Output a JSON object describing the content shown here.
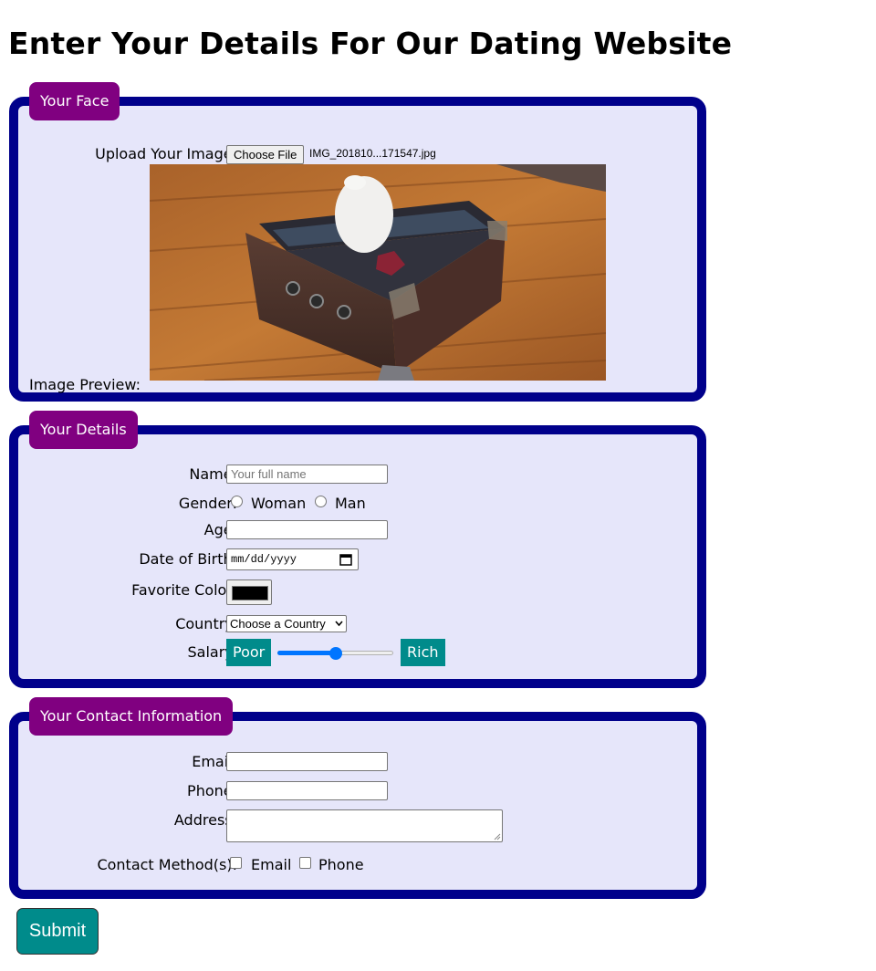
{
  "page": {
    "title": "Enter Your Details For Our Dating Website"
  },
  "face": {
    "legend": "Your Face",
    "upload_label": "Upload Your Image:",
    "choose_file_label": "Choose File",
    "file_name": "IMG_201810...171547.jpg",
    "preview_label": "Image Preview:"
  },
  "details": {
    "legend": "Your Details",
    "name_label": "Name:",
    "name_placeholder": "Your full name",
    "gender_label": "Gender:",
    "gender_options": [
      "Woman",
      "Man"
    ],
    "age_label": "Age:",
    "dob_label": "Date of Birth:",
    "dob_placeholder": "mm/dd/yyyy",
    "color_label": "Favorite Color:",
    "color_value": "#000000",
    "country_label": "Country:",
    "country_selected": "Choose a Country",
    "salary_label": "Salary:",
    "salary_min_label": "Poor",
    "salary_max_label": "Rich",
    "salary_value": 0.5
  },
  "contact": {
    "legend": "Your Contact Information",
    "email_label": "Email:",
    "phone_label": "Phone:",
    "address_label": "Address:",
    "method_label": "Contact Method(s):",
    "method_options": [
      "Email",
      "Phone"
    ]
  },
  "submit_label": "Submit",
  "colors": {
    "panel_bg": "#e6e6fa",
    "panel_border": "#00008b",
    "legend_bg": "#800080",
    "accent_teal": "#008b8b"
  }
}
